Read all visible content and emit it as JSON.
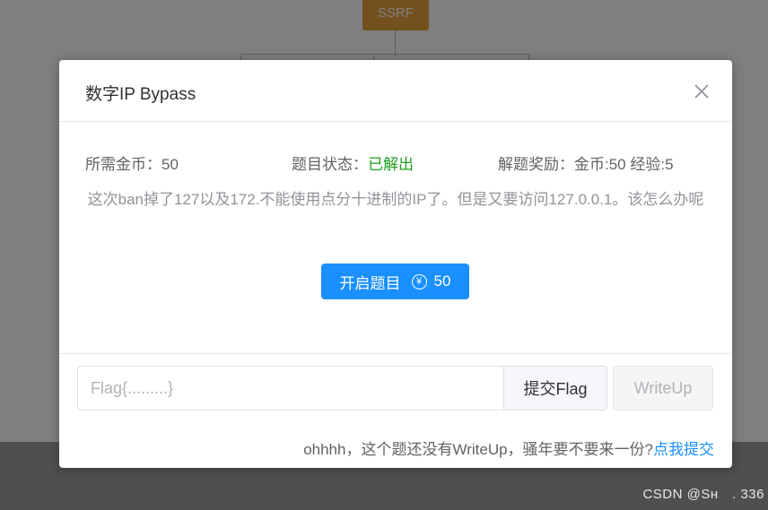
{
  "background": {
    "node_label": "SSRF",
    "watermark": "CSDN @Sн　. 336"
  },
  "dialog": {
    "title": "数字IP Bypass",
    "info": {
      "cost": "所需金币：50",
      "status_label": "题目状态：",
      "status_value": "已解出",
      "reward": "解题奖励：金币:50 经验:5"
    },
    "description": "这次ban掉了127以及172.不能使用点分十进制的IP了。但是又要访问127.0.0.1。该怎么办呢",
    "start_button": {
      "label": "开启题目",
      "currency_symbol": "¥",
      "cost": "50"
    },
    "flag_input": {
      "value": "",
      "placeholder": "Flag{.........}"
    },
    "submit_label": "提交Flag",
    "writeup_label": "WriteUp",
    "writeup_note": "ohhhh，这个题还没有WriteUp，骚年要不要来一份?",
    "writeup_link": "点我提交"
  },
  "colors": {
    "primary": "#1a90ff",
    "solved": "#1f9e1f",
    "node": "#e6a23c"
  }
}
